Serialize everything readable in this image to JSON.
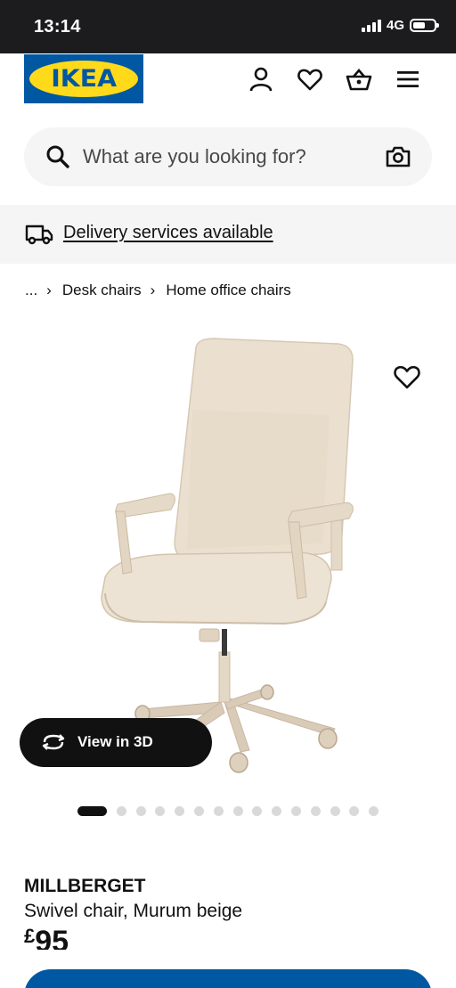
{
  "status_bar": {
    "time": "13:14",
    "network": "4G",
    "battery_level": 0.6
  },
  "header": {
    "logo_text": "IKEA",
    "icons": [
      "user-icon",
      "heart-icon",
      "basket-icon",
      "menu-icon"
    ]
  },
  "search": {
    "placeholder": "What are you looking for?"
  },
  "delivery": {
    "label": "Delivery services available"
  },
  "breadcrumb": {
    "ellipsis": "...",
    "items": [
      "Desk chairs",
      "Home office chairs"
    ]
  },
  "gallery": {
    "view_3d_label": "View in 3D",
    "image_count": 15,
    "active_index": 0
  },
  "product": {
    "name": "MILLBERGET",
    "description": "Swivel chair, Murum beige",
    "price_currency": "£",
    "price_value": "95"
  },
  "colors": {
    "brand_blue": "#0058a3",
    "brand_yellow": "#ffda1a",
    "status_bar": "#1c1c1e",
    "chair_beige": "#e8dccb"
  }
}
